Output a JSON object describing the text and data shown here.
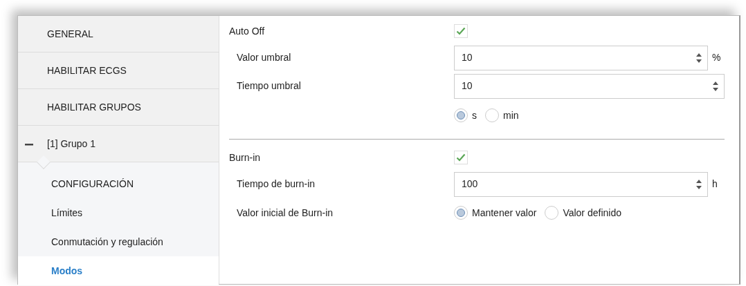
{
  "sidebar": {
    "items": [
      {
        "label": "GENERAL",
        "selected": false
      },
      {
        "label": "HABILITAR ECGS",
        "selected": false
      },
      {
        "label": "HABILITAR GRUPOS",
        "selected": false
      },
      {
        "label": "[1] Grupo 1",
        "selected": false,
        "expanded": true,
        "children": [
          {
            "label": "CONFIGURACIÓN",
            "selected": false
          },
          {
            "label": "Límites",
            "selected": false
          },
          {
            "label": "Conmutación y regulación",
            "selected": false
          },
          {
            "label": "Modos",
            "selected": true
          }
        ]
      }
    ]
  },
  "sections": [
    {
      "rows": [
        {
          "kind": "checkbox",
          "label": "Auto Off",
          "checked": true
        },
        {
          "kind": "spinbox",
          "label": "Valor umbral",
          "value": "10",
          "unit": "%"
        },
        {
          "kind": "spinbox",
          "label": "Tiempo umbral",
          "value": "10"
        },
        {
          "kind": "radio",
          "options": [
            {
              "label": "s",
              "selected": true
            },
            {
              "label": "min",
              "selected": false
            }
          ]
        }
      ]
    },
    {
      "rows": [
        {
          "kind": "checkbox",
          "label": "Burn-in",
          "checked": true
        },
        {
          "kind": "spinbox",
          "label": "Tiempo de burn-in",
          "value": "100",
          "unit": "h"
        },
        {
          "kind": "radio",
          "label": "Valor inicial de Burn-in",
          "options": [
            {
              "label": "Mantener valor",
              "selected": true
            },
            {
              "label": "Valor definido",
              "selected": false
            }
          ]
        }
      ]
    }
  ]
}
